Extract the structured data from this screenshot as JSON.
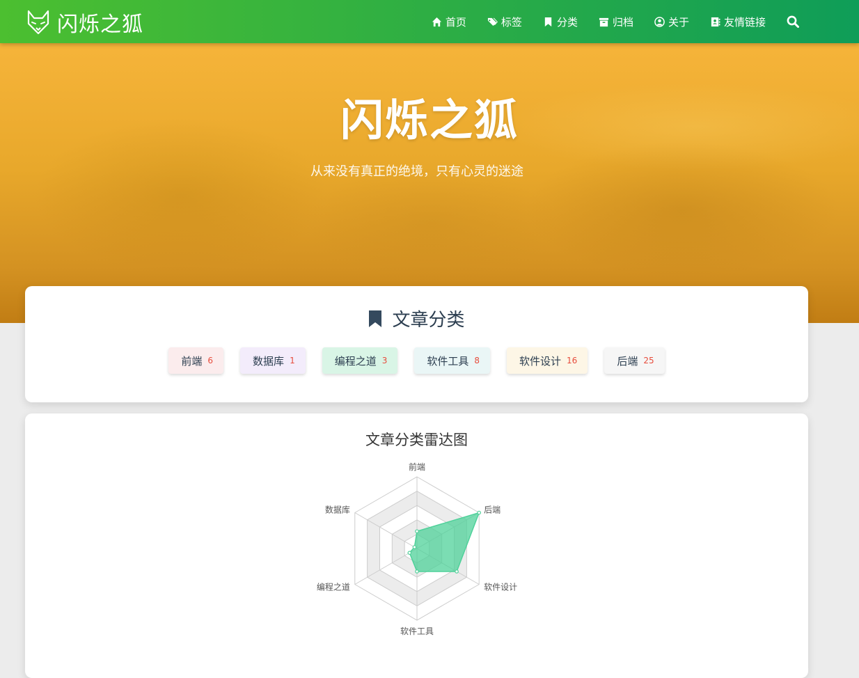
{
  "navbar": {
    "brand": "闪烁之狐",
    "items": [
      {
        "label": "首页",
        "icon": "home-icon"
      },
      {
        "label": "标签",
        "icon": "tags-icon"
      },
      {
        "label": "分类",
        "icon": "bookmark-icon"
      },
      {
        "label": "归档",
        "icon": "archive-icon"
      },
      {
        "label": "关于",
        "icon": "user-circle-icon"
      },
      {
        "label": "友情链接",
        "icon": "address-book-icon"
      }
    ],
    "search_icon": "search-icon"
  },
  "hero": {
    "title": "闪烁之狐",
    "subtitle": "从来没有真正的绝境，只有心灵的迷途"
  },
  "categories": {
    "title": "文章分类",
    "chips": [
      {
        "name": "前端",
        "count": "6",
        "bg": "#fbeced"
      },
      {
        "name": "数据库",
        "count": "1",
        "bg": "#f3ecfb"
      },
      {
        "name": "编程之道",
        "count": "3",
        "bg": "#d9f5e6"
      },
      {
        "name": "软件工具",
        "count": "8",
        "bg": "#eaf6f6"
      },
      {
        "name": "软件设计",
        "count": "16",
        "bg": "#fdf6e6"
      },
      {
        "name": "后端",
        "count": "25",
        "bg": "#f6f6f6"
      }
    ]
  },
  "radar": {
    "title": "文章分类雷达图"
  },
  "chart_data": {
    "type": "radar",
    "title": "文章分类雷达图",
    "indicators": [
      "前端",
      "后端",
      "软件设计",
      "软件工具",
      "编程之道",
      "数据库"
    ],
    "values": [
      6,
      25,
      16,
      8,
      3,
      1
    ],
    "max": 25,
    "levels": 5,
    "fill_color": "#4fd19a"
  }
}
